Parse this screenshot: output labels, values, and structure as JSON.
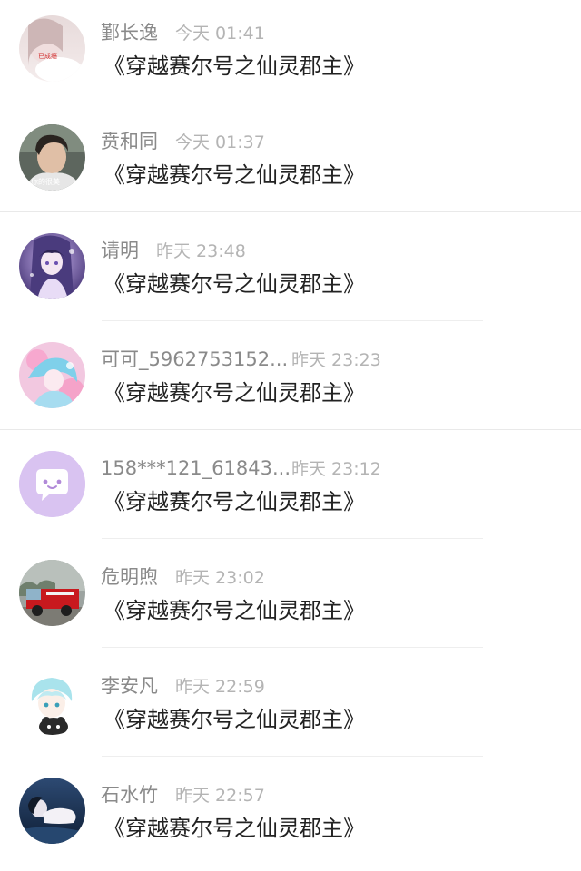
{
  "messages": [
    {
      "name": "鄞长逸",
      "time": "今天 01:41",
      "text": "《穿越赛尔号之仙灵郡主》",
      "avatar_icon": "avatar-photo-girl-icon",
      "avatar_text": "已成瘾"
    },
    {
      "name": "贲和同",
      "time": "今天 01:37",
      "text": "《穿越赛尔号之仙灵郡主》",
      "avatar_icon": "avatar-photo-man-icon",
      "avatar_text": "你的很美"
    },
    {
      "name": "请明",
      "time": "昨天 23:48",
      "text": "《穿越赛尔号之仙灵郡主》",
      "avatar_icon": "avatar-anime-girl-purple-icon"
    },
    {
      "name": "可可_5962753152...",
      "time": "昨天 23:23",
      "text": "《穿越赛尔号之仙灵郡主》",
      "avatar_icon": "avatar-anime-girl-blue-icon"
    },
    {
      "name": "158***121_61843...",
      "time": "昨天 23:12",
      "text": "《穿越赛尔号之仙灵郡主》",
      "avatar_icon": "avatar-default-chat-bubble-icon"
    },
    {
      "name": "危明煦",
      "time": "昨天 23:02",
      "text": "《穿越赛尔号之仙灵郡主》",
      "avatar_icon": "avatar-fire-truck-icon"
    },
    {
      "name": "李安凡",
      "time": "昨天 22:59",
      "text": "《穿越赛尔号之仙灵郡主》",
      "avatar_icon": "avatar-anime-boy-icon"
    },
    {
      "name": "石水竹",
      "time": "昨天 22:57",
      "text": "《穿越赛尔号之仙灵郡主》",
      "avatar_icon": "avatar-photo-lying-girl-icon"
    }
  ],
  "colors": {
    "name": "#8a8a8a",
    "time": "#b4b4b4",
    "message": "#222222",
    "divider": "#eeeeee",
    "default_avatar_bg": "#d9c3f1"
  }
}
